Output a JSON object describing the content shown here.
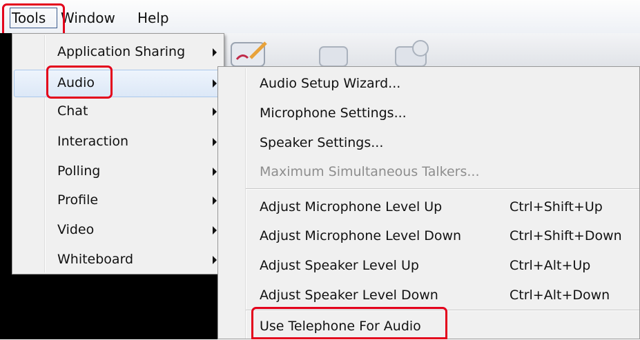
{
  "menubar": {
    "items": [
      "Tools",
      "Window",
      "Help"
    ]
  },
  "tools_menu": {
    "items": [
      {
        "label": "Application Sharing",
        "has_submenu": true
      },
      {
        "label": "Audio",
        "has_submenu": true,
        "active": true
      },
      {
        "label": "Chat",
        "has_submenu": true
      },
      {
        "label": "Interaction",
        "has_submenu": true
      },
      {
        "label": "Polling",
        "has_submenu": true
      },
      {
        "label": "Profile",
        "has_submenu": true
      },
      {
        "label": "Video",
        "has_submenu": true
      },
      {
        "label": "Whiteboard",
        "has_submenu": true
      }
    ]
  },
  "audio_menu": {
    "items": [
      {
        "label": "Audio Setup Wizard...",
        "shortcut": ""
      },
      {
        "label": "Microphone Settings...",
        "shortcut": ""
      },
      {
        "label": "Speaker Settings...",
        "shortcut": ""
      },
      {
        "label": "Maximum Simultaneous Talkers...",
        "shortcut": "",
        "disabled": true
      },
      {
        "label": "Adjust Microphone Level Up",
        "shortcut": "Ctrl+Shift+Up"
      },
      {
        "label": "Adjust Microphone Level Down",
        "shortcut": "Ctrl+Shift+Down"
      },
      {
        "label": "Adjust Speaker Level Up",
        "shortcut": "Ctrl+Alt+Up"
      },
      {
        "label": "Adjust Speaker Level Down",
        "shortcut": "Ctrl+Alt+Down"
      },
      {
        "label": "Use Telephone For Audio",
        "shortcut": ""
      }
    ]
  },
  "colors": {
    "highlight_box": "#e3001b",
    "menu_bg": "#f0f0f0",
    "active_row": "#dce8f7"
  }
}
